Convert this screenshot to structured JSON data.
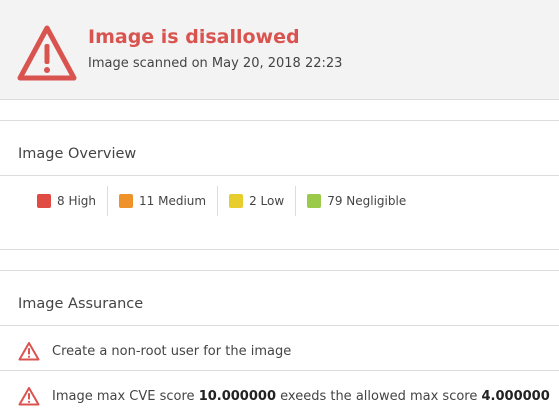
{
  "banner": {
    "title": "Image is disallowed",
    "subtitle": "Image scanned on May 20, 2018 22:23",
    "icon": "warning-triangle-icon",
    "color": "#d9534f"
  },
  "overview": {
    "title": "Image Overview",
    "chips": [
      {
        "label": "8 High",
        "color": "#e04b43"
      },
      {
        "label": "11 Medium",
        "color": "#f0922a"
      },
      {
        "label": "2 Low",
        "color": "#e8cd2e"
      },
      {
        "label": "79 Negligible",
        "color": "#9bc94a"
      }
    ]
  },
  "assurance": {
    "title": "Image Assurance",
    "items": [
      {
        "text": "Create a non-root user for the image"
      },
      {
        "pre": "Image max CVE score ",
        "score": "10.000000",
        "mid": " exeeds the allowed max score ",
        "max": "4.000000"
      }
    ]
  }
}
